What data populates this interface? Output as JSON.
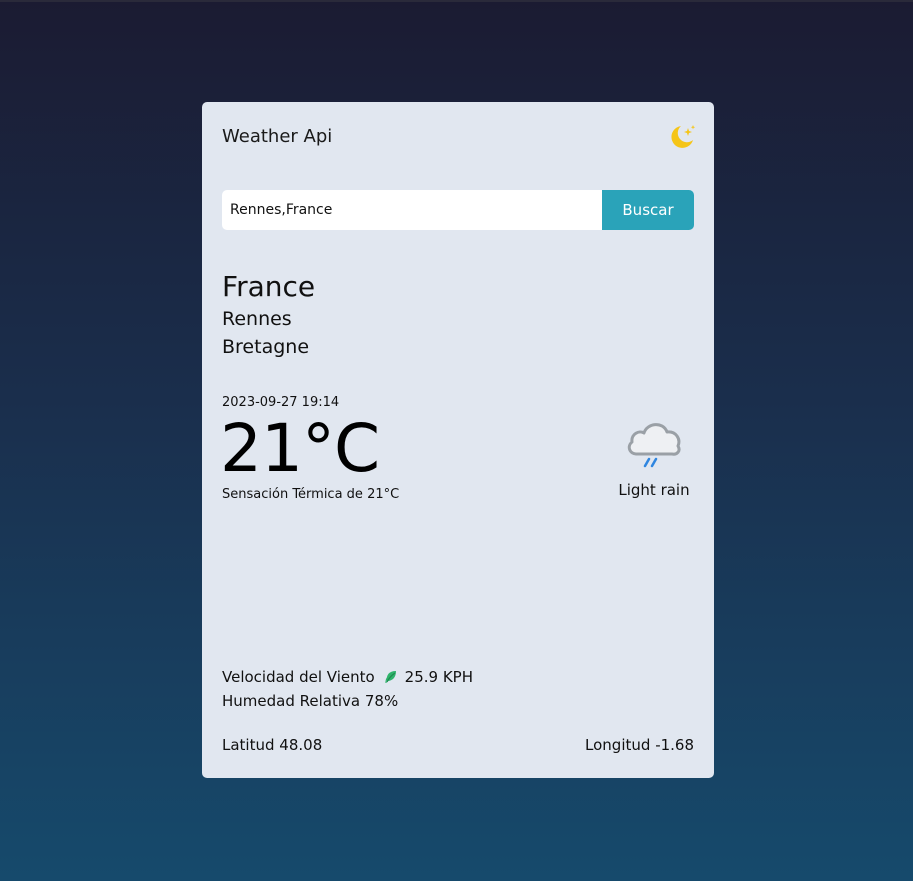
{
  "header": {
    "title": "Weather Api",
    "theme_icon": "moon-stars-icon",
    "theme_icon_color": "#f5c518"
  },
  "search": {
    "value": "Rennes,France",
    "placeholder": "",
    "button_label": "Buscar",
    "button_color": "#2aa3b9"
  },
  "location": {
    "country": "France",
    "city": "Rennes",
    "region": "Bretagne"
  },
  "current": {
    "datetime": "2023-09-27 19:14",
    "temperature": "21°C",
    "feels_like_label": "Sensación Térmica de",
    "feels_like_value": "21°C",
    "condition": "Light rain",
    "condition_icon": "light-rain-cloud-icon"
  },
  "details": {
    "wind_label": "Velocidad del Viento",
    "wind_icon": "leaf-icon",
    "wind_value": "25.9 KPH",
    "humidity_label": "Humedad Relativa",
    "humidity_value": "78%",
    "latitude_label": "Latitud",
    "latitude_value": "48.08",
    "longitude_label": "Longitud",
    "longitude_value": "-1.68"
  }
}
